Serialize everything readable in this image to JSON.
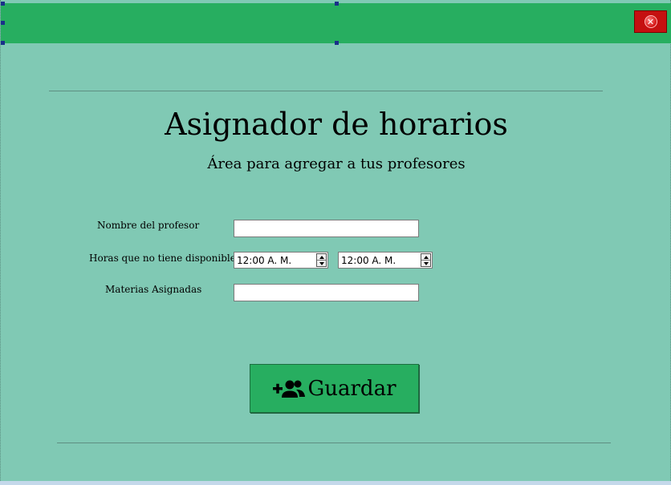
{
  "window": {
    "close_glyph": "✕"
  },
  "header": {
    "title": "Asignador de horarios",
    "subtitle": "Área para agregar a tus profesores"
  },
  "form": {
    "teacher_name": {
      "label": "Nombre del profesor",
      "value": ""
    },
    "unavailable_hours": {
      "label": "Horas que no tiene disponible",
      "from": "12:00 A. M.",
      "to": "12:00 A. M."
    },
    "subjects": {
      "label": "Materias Asignadas",
      "value": ""
    }
  },
  "actions": {
    "save_label": "Guardar",
    "save_icon": "add-users-icon"
  },
  "colors": {
    "header_green": "#27ae60",
    "panel_teal": "#80c9b4",
    "close_red": "#c51010"
  }
}
